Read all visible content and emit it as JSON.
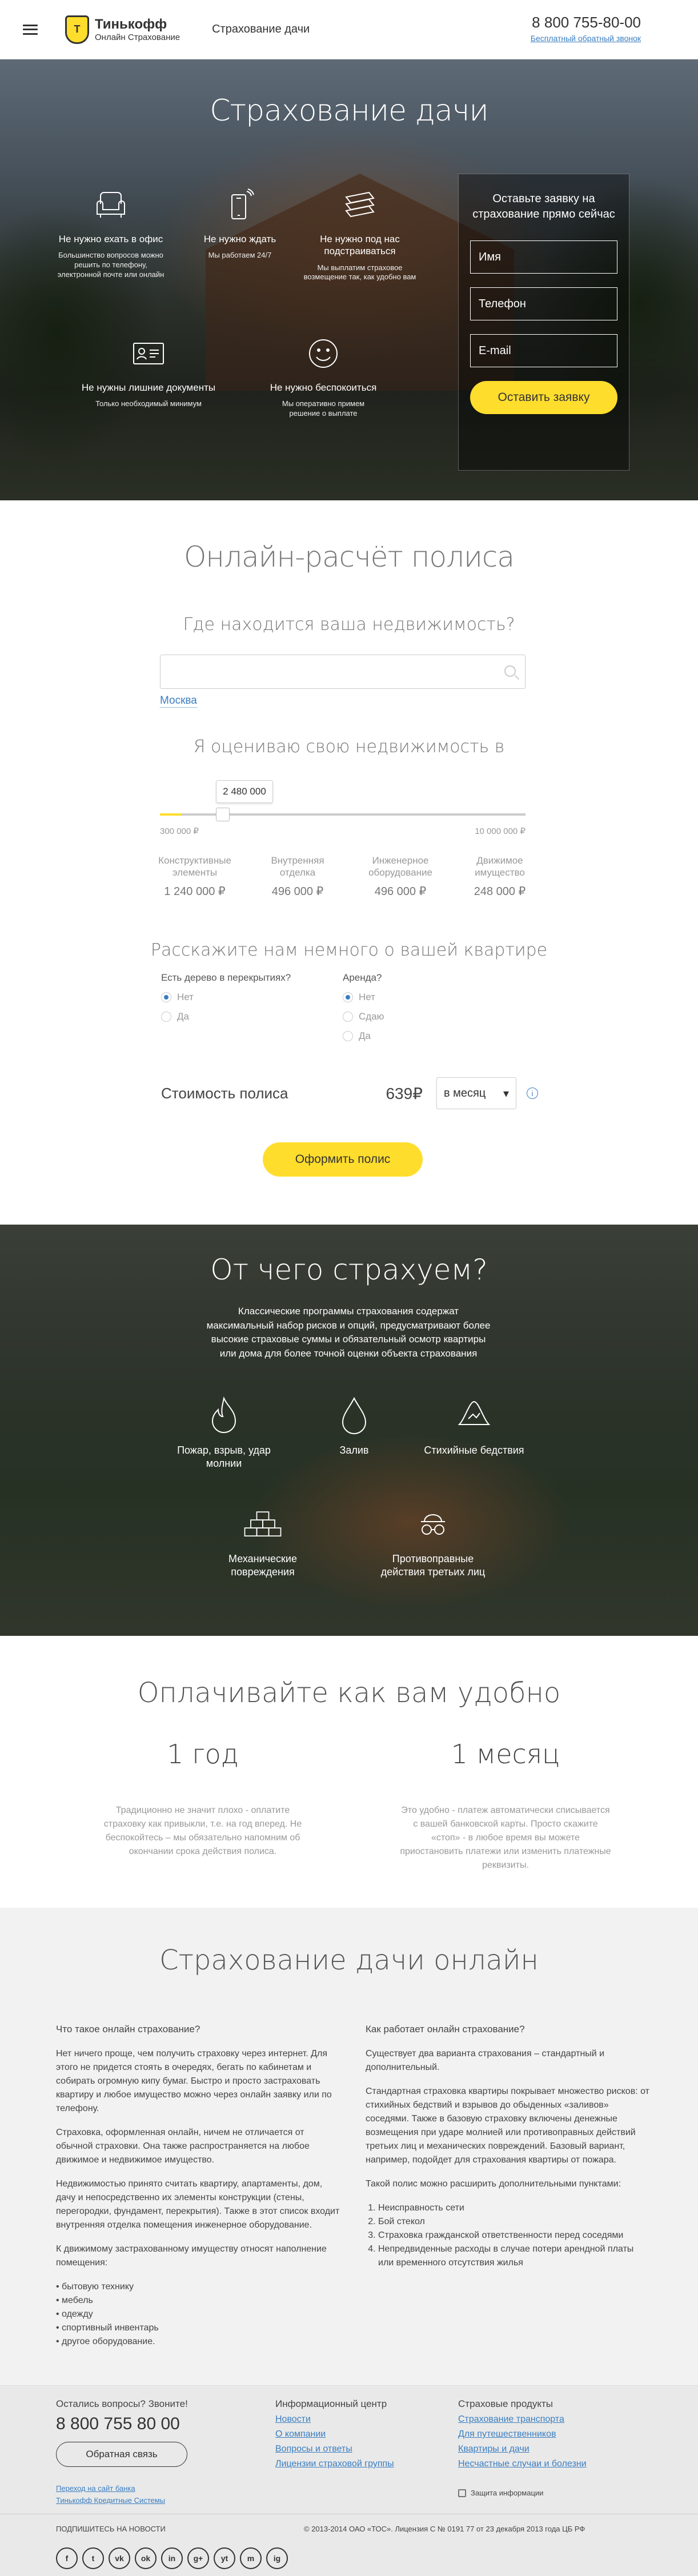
{
  "header": {
    "logo_name": "Тинькофф",
    "logo_sub": "Онлайн Страхование",
    "title": "Страхование дачи",
    "phone": "8 800 755-80-00",
    "callback": "Бесплатный обратный звонок"
  },
  "hero": {
    "title": "Страхование дачи",
    "features": [
      {
        "icon": "armchair-icon",
        "title": "Не нужно ехать в офис",
        "desc": "Большинство вопросов можно решить по телефону, электронной почте или онлайн"
      },
      {
        "icon": "phone-icon",
        "title": "Не нужно ждать",
        "desc": "Мы работаем 24/7"
      },
      {
        "icon": "cash-icon",
        "title": "Не нужно под нас подстраиваться",
        "desc": "Мы выплатим страховое возмещение так, как удобно вам"
      },
      {
        "icon": "document-icon",
        "title": "Не нужны лишние документы",
        "desc": "Только необходимый минимум"
      },
      {
        "icon": "smile-icon",
        "title": "Не нужно беспокоиться",
        "desc": "Мы оперативно примем решение о выплате"
      }
    ],
    "form": {
      "title": "Оставьте заявку на страхование прямо сейчас",
      "name_ph": "Имя",
      "phone_ph": "Телефон",
      "email_ph": "E-mail",
      "submit": "Оставить заявку"
    }
  },
  "calc": {
    "title": "Онлайн-расчёт полиса",
    "where_q": "Где находится ваша недвижимость?",
    "city": "Москва",
    "estimate_lbl": "Я оцениваю свою недвижимость в",
    "slider_value": "2 480 000",
    "slider_fraction": 0.06,
    "range_min": "300 000 ₽",
    "range_max": "10 000 000 ₽",
    "categories": [
      {
        "name": "Конструктивные элементы",
        "amount": "1 240 000 ₽"
      },
      {
        "name": "Внутренняя отделка",
        "amount": "496 000 ₽"
      },
      {
        "name": "Инженерное оборудование",
        "amount": "496 000 ₽"
      },
      {
        "name": "Движимое имущество",
        "amount": "248 000 ₽"
      }
    ],
    "questions_title": "Расскажите нам немного о вашей квартире",
    "q1": {
      "label": "Есть дерево в перекрытиях?",
      "options": [
        "Нет",
        "Да"
      ]
    },
    "q2": {
      "label": "Аренда?",
      "options": [
        "Нет",
        "Сдаю",
        "Да"
      ]
    },
    "cost_label": "Стоимость полиса",
    "cost_value": "639₽",
    "period": "в месяц",
    "info": "i",
    "order_btn": "Оформить полис"
  },
  "risks": {
    "title": "От чего страхуем?",
    "desc": "Классические программы страхования содержат максимальный набор рисков и опций, предусматривают более высокие страховые суммы и обязательный осмотр квартиры или дома для более точной оценки объекта страхования",
    "items": [
      {
        "icon": "fire-icon",
        "label": "Пожар, взрыв, удар молнии"
      },
      {
        "icon": "drop-icon",
        "label": "Залив"
      },
      {
        "icon": "storm-icon",
        "label": "Стихийные бедствия"
      },
      {
        "icon": "bricks-icon",
        "label": "Механические повреждения"
      },
      {
        "icon": "thief-icon",
        "label": "Противоправные действия третьих лиц"
      }
    ]
  },
  "pay": {
    "title": "Оплачивайте как вам удобно",
    "year_title": "1 год",
    "year_text": "Традиционно не значит плохо - оплатите страховку как привыкли, т.е. на год вперед. Не беспокойтесь – мы обязательно напомним об окончании срока действия полиса.",
    "month_title": "1 месяц",
    "month_text": "Это удобно - платеж автоматически списывается с вашей банковской карты. Просто скажите «стоп» - в любое время вы можете приостановить платежи или изменить платежные реквизиты."
  },
  "about": {
    "title": "Страхование дачи онлайн",
    "left_h": "Что такое онлайн страхование?",
    "left_p1": "Нет ничего проще, чем получить страховку через интернет. Для этого не придется стоять в очередях, бегать по кабинетам и собирать огромную кипу бумаг. Быстро и просто застраховать квартиру и любое имущество можно через онлайн заявку или по телефону.",
    "left_p2": "Страховка, оформленная онлайн, ничем не отличается от обычной страховки. Она также распространяется на любое движимое и недвижимое имущество.",
    "left_p3": "Недвижимостью принято считать квартиру, апартаменты, дом, дачу и непосредственно их элементы конструкции (стены, перегородки, фундамент, перекрытия). Также в этот список входит внутренняя отделка помещения инженерное оборудование.",
    "left_p4": "К движимому застрахованному имуществу относят наполнение помещения:",
    "left_list": [
      "бытовую технику",
      "мебель",
      "одежду",
      "спортивный инвентарь",
      "другое оборудование."
    ],
    "right_h": "Как работает онлайн страхование?",
    "right_p1": "Существует два варианта страхования – стандартный и дополнительный.",
    "right_p2": "Стандартная страховка квартиры покрывает множество рисков: от стихийных бедствий и взрывов до обыденных «заливов» соседями. Также в базовую страховку включены денежные возмещения при ударе молнией или противоправных действий третьих лиц и механических повреждений. Базовый вариант, например, подойдет для страхования квартиры от пожара.",
    "right_p3": "Такой полис можно расширить дополнительными пунктами:",
    "right_list": [
      "Неисправность сети",
      "Бой стекол",
      "Страховка гражданской ответственности перед соседями",
      "Непредвиденные расходы в случае потери арендной платы или временного отсутствия жилья"
    ]
  },
  "footer": {
    "q_title": "Остались вопросы? Звоните!",
    "phone": "8 800 755 80 00",
    "feedback": "Обратная связь",
    "info_title": "Информационный центр",
    "info_links": [
      "Новости",
      "О компании",
      "Вопросы и ответы",
      "Лицензии страховой группы"
    ],
    "prod_title": "Страховые продукты",
    "prod_links": [
      "Страхование транспорта",
      "Для путешественников",
      "Квартиры и дачи",
      "Несчастные случаи и болезни"
    ],
    "bank_link1": "Переход на сайт банка",
    "bank_link2": "Тинькофф Кредитные Системы",
    "secure": "Защита информации",
    "subscribe": "ПОДПИШИТЕСЬ НА НОВОСТИ",
    "copyright": "© 2013-2014 ОАО «ТОС». Лицензия С № 0191 77 от 23 декабря 2013 года ЦБ РФ",
    "socials": [
      "f",
      "t",
      "vk",
      "ok",
      "in",
      "g+",
      "yt",
      "m",
      "ig"
    ]
  }
}
